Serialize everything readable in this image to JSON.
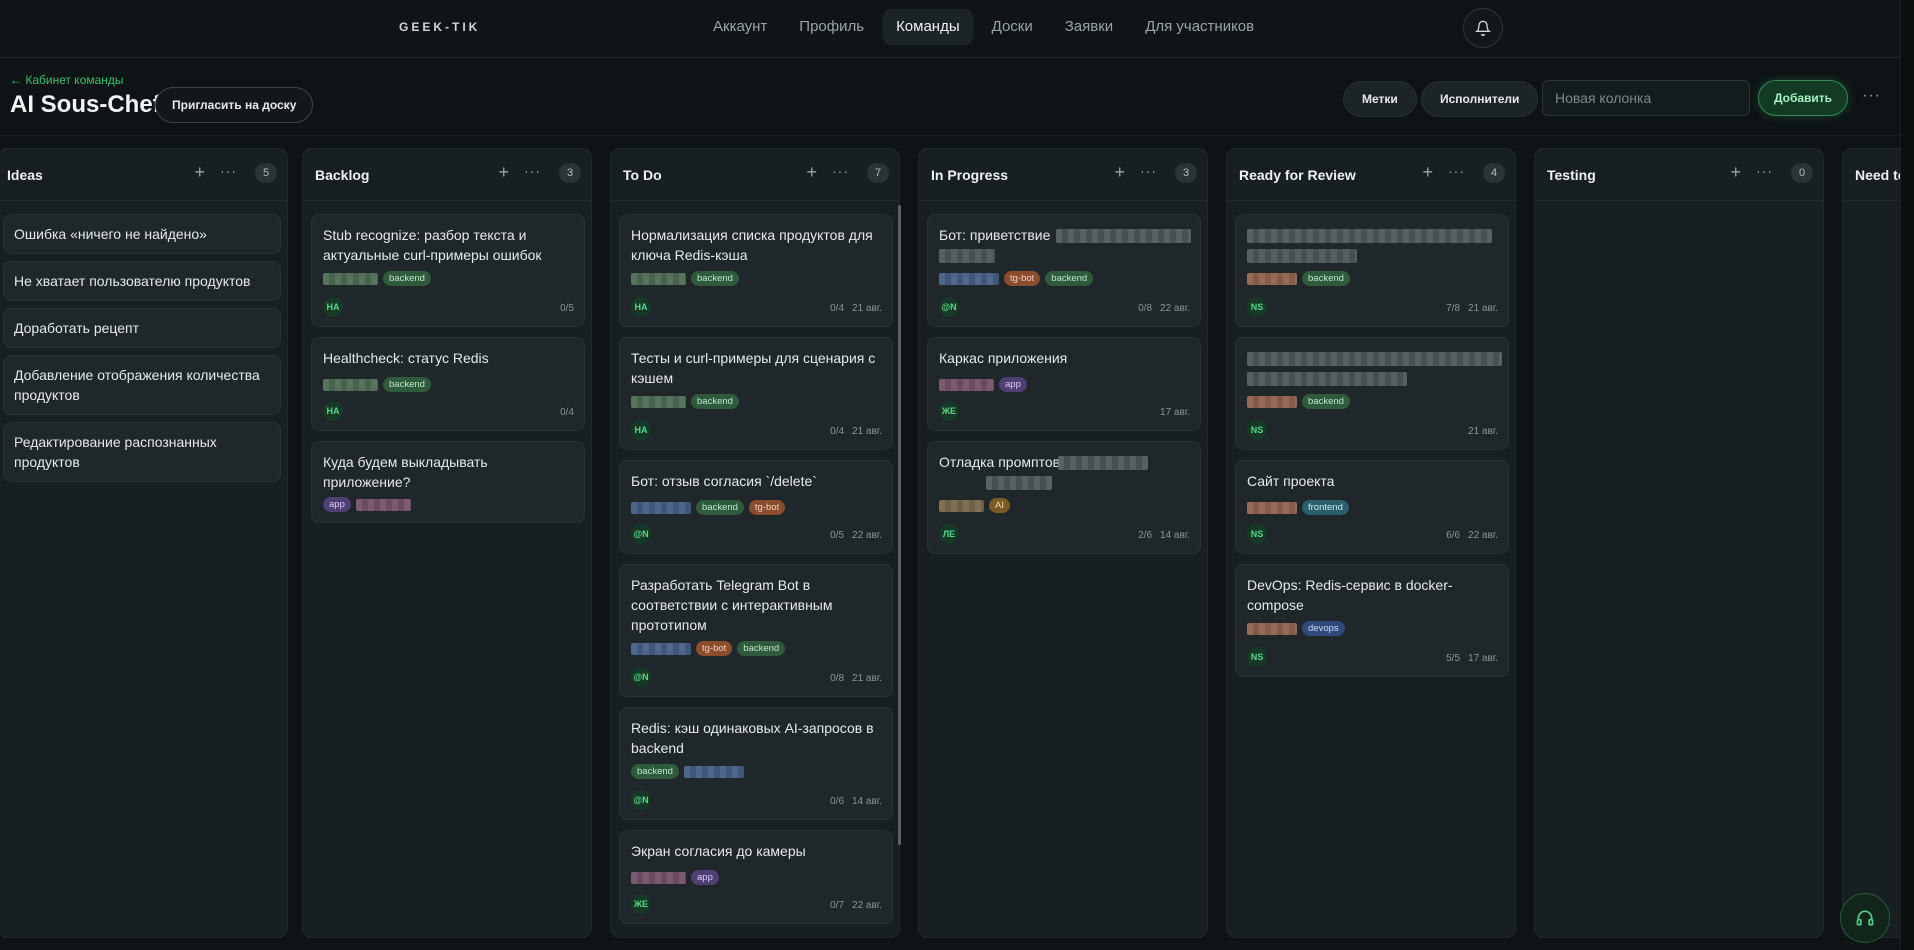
{
  "nav": {
    "brand": "GEEK-TIK",
    "links": [
      "Аккаунт",
      "Профиль",
      "Команды",
      "Доски",
      "Заявки",
      "Для участников"
    ],
    "active": "Команды"
  },
  "header": {
    "back_link": "← Кабинет команды",
    "title": "AI Sous-Chef",
    "invite_label": "Пригласить на доску",
    "labels_btn": "Метки",
    "assignees_btn": "Исполнители",
    "new_column_placeholder": "Новая колонка",
    "add_btn": "Добавить"
  },
  "columns": [
    {
      "title": "Ideas",
      "count": "5",
      "items": [
        "Ошибка «ничего не найдено»",
        "Не хватает пользователю продуктов",
        "Доработать рецепт",
        "Добавление отображения количества продуктов",
        "Редактирование распознанных продуктов"
      ]
    },
    {
      "title": "Backlog",
      "count": "3",
      "cards": [
        {
          "title": "Stub recognize: разбор текста и актуальные curl-примеры ошибок",
          "tags": [
            "backend"
          ],
          "avatar": "НА",
          "progress": "0/5",
          "date": ""
        },
        {
          "title": "Healthcheck: статус Redis",
          "tags": [
            "backend"
          ],
          "avatar": "НА",
          "progress": "0/4",
          "date": ""
        },
        {
          "title": "Куда будем выкладывать приложение?",
          "tags": [
            "app"
          ],
          "avatar": "",
          "progress": "",
          "date": ""
        }
      ]
    },
    {
      "title": "To Do",
      "count": "7",
      "cards": [
        {
          "title": "Нормализация списка продуктов для ключа Redis-кэша",
          "tags": [
            "backend"
          ],
          "avatar": "НА",
          "progress": "0/4",
          "date": "21 авг."
        },
        {
          "title": "Тесты и curl-примеры для сценария с кэшем",
          "tags": [
            "backend"
          ],
          "avatar": "НА",
          "progress": "0/4",
          "date": "21 авг."
        },
        {
          "title": "Бот: отзыв согласия `/delete`",
          "tags": [
            "backend",
            "tg-bot"
          ],
          "avatar": "@N",
          "progress": "0/5",
          "date": "22 авг."
        },
        {
          "title": "Разработать Telegram Bot в соответствии с интерактивным прототипом",
          "tags": [
            "tg-bot",
            "backend"
          ],
          "avatar": "@N",
          "progress": "0/8",
          "date": "21 авг."
        },
        {
          "title": "Redis: кэш одинаковых AI-запросов в backend",
          "tags": [
            "backend"
          ],
          "avatar": "@N",
          "progress": "0/6",
          "date": "14 авг."
        },
        {
          "title": "Экран согласия до камеры",
          "tags": [
            "app"
          ],
          "avatar": "ЖЕ",
          "progress": "0/7",
          "date": "22 авг."
        }
      ]
    },
    {
      "title": "In Progress",
      "count": "3",
      "cards": [
        {
          "title": "Бот: приветствие",
          "tags": [
            "tg-bot",
            "backend"
          ],
          "avatar": "@N",
          "progress": "0/8",
          "date": "22 авг."
        },
        {
          "title": "Каркас приложения",
          "tags": [
            "app"
          ],
          "avatar": "ЖЕ",
          "progress": "",
          "date": "17 авг."
        },
        {
          "title": "Отладка промптов",
          "tags": [
            "AI"
          ],
          "avatar": "ЛЕ",
          "progress": "2/6",
          "date": "14 авг."
        }
      ]
    },
    {
      "title": "Ready for Review",
      "count": "4",
      "cards": [
        {
          "title": "",
          "tags": [
            "backend"
          ],
          "avatar": "NS",
          "progress": "7/8",
          "date": "21 авг."
        },
        {
          "title": "",
          "tags": [
            "backend"
          ],
          "avatar": "NS",
          "progress": "",
          "date": "21 авг."
        },
        {
          "title": "Сайт проекта",
          "tags": [
            "frontend"
          ],
          "avatar": "NS",
          "progress": "6/6",
          "date": "22 авг."
        },
        {
          "title": "DevOps: Redis-сервис в docker-compose",
          "tags": [
            "devops"
          ],
          "avatar": "NS",
          "progress": "5/5",
          "date": "17 авг."
        }
      ]
    },
    {
      "title": "Testing",
      "count": "0",
      "cards": []
    },
    {
      "title": "Need to l",
      "count": "",
      "cards": []
    }
  ]
}
